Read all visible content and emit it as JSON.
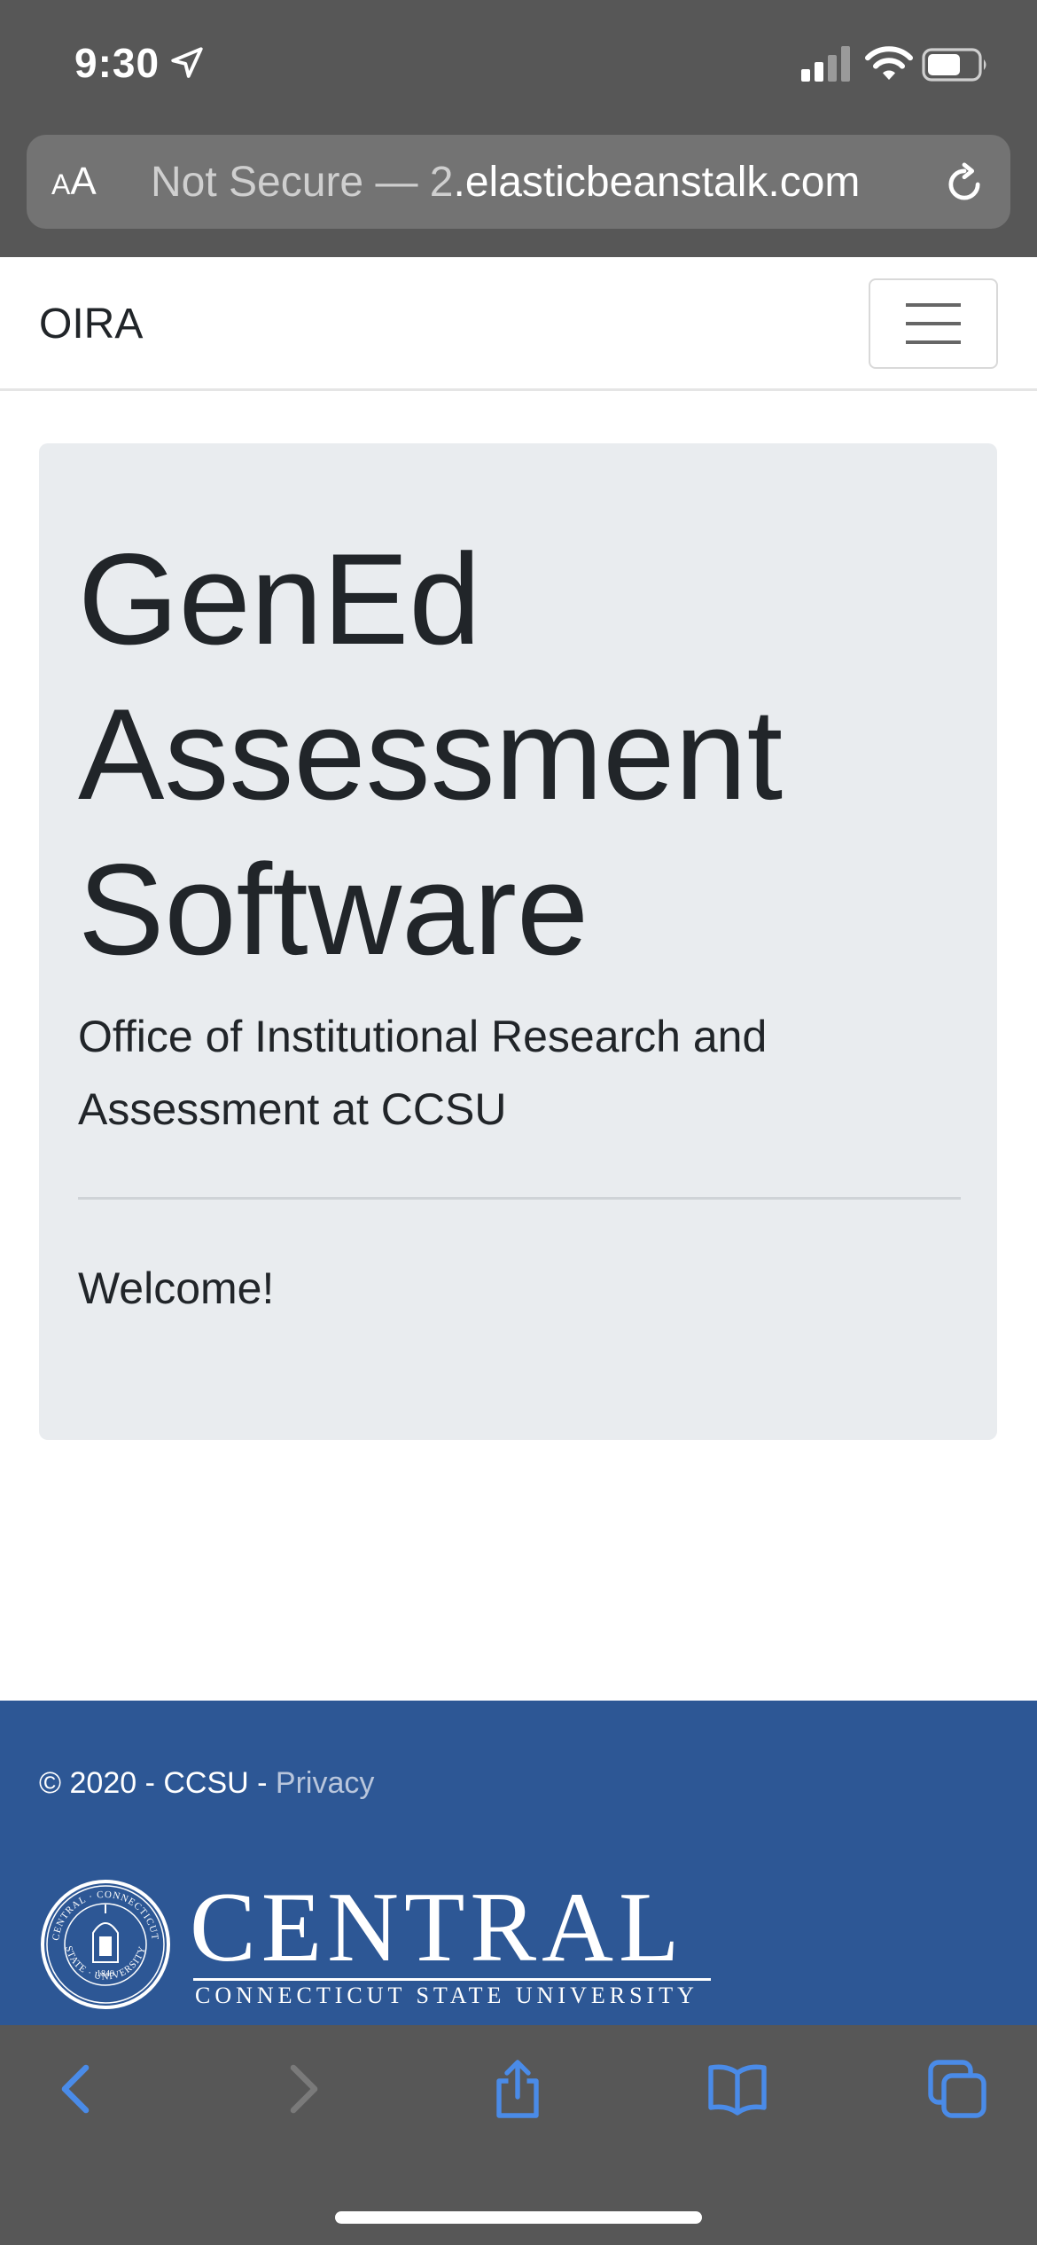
{
  "status_bar": {
    "time": "9:30"
  },
  "browser": {
    "aa_small": "A",
    "aa_large": "A",
    "url_prefix": "Not Secure — ",
    "url_fragment": "2",
    "url_domain": ".elasticbeanstalk.com"
  },
  "navbar": {
    "brand": "OIRA"
  },
  "hero": {
    "title": "GenEd Assessment Software",
    "lead": "Office of Institutional Research and Assessment at CCSU",
    "welcome": "Welcome!"
  },
  "footer": {
    "copyright": "© 2020 - CCSU - ",
    "privacy_link": "Privacy",
    "logo_word": "CENTRAL",
    "logo_subtitle": "CONNECTICUT STATE UNIVERSITY",
    "seal_text_top": "CENTRAL · CONNECTICUT",
    "seal_text_bottom": "STATE · UNIVERSITY",
    "seal_year": "1849"
  },
  "colors": {
    "chrome": "#575757",
    "accent_blue": "#4a8be8",
    "footer_bg": "#2d5795",
    "jumbotron_bg": "#e9ecef"
  },
  "icons": {
    "location": "location-arrow-icon",
    "signal": "cellular-signal-icon",
    "wifi": "wifi-icon",
    "battery": "battery-icon",
    "reload": "reload-icon",
    "menu": "hamburger-menu-icon",
    "back": "back-chevron-icon",
    "forward": "forward-chevron-icon",
    "share": "share-icon",
    "bookmarks": "bookmarks-icon",
    "tabs": "tabs-icon"
  }
}
